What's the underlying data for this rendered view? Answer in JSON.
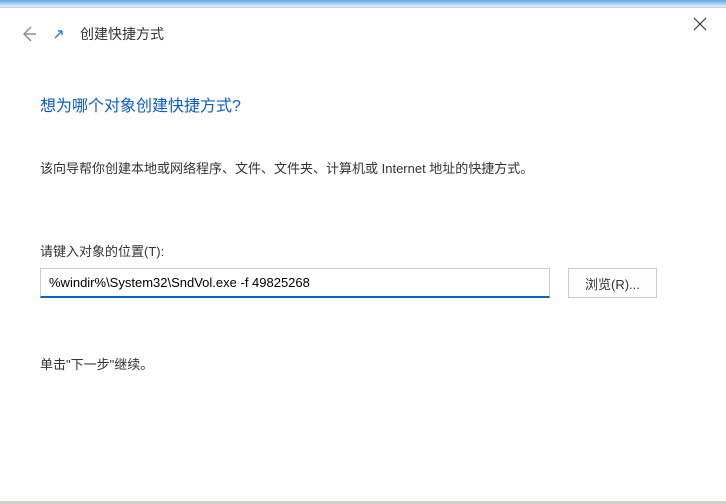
{
  "window": {
    "title": "创建快捷方式"
  },
  "main": {
    "question": "想为哪个对象创建快捷方式?",
    "description": "该向导帮你创建本地或网络程序、文件、文件夹、计算机或 Internet 地址的快捷方式。",
    "locationLabel": "请键入对象的位置(T):",
    "locationValue": "%windir%\\System32\\SndVol.exe -f 49825268",
    "browseLabel": "浏览(R)...",
    "continueText": "单击\"下一步\"继续。"
  }
}
